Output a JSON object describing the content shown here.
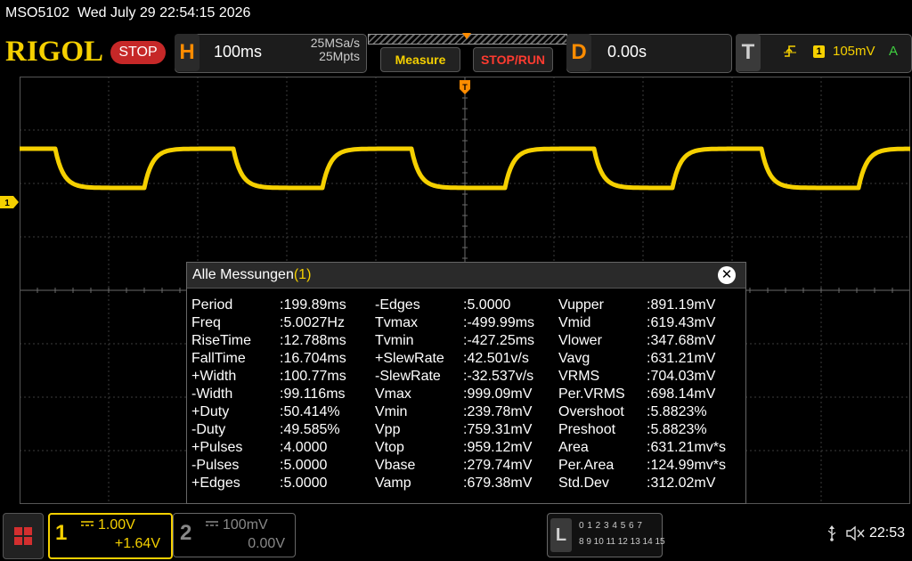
{
  "status": {
    "model": "MSO5102",
    "datetime": "Wed July 29 22:54:15 2026"
  },
  "toolbar": {
    "logo": "RIGOL",
    "run_state": "STOP",
    "horizontal": {
      "letter": "H",
      "timebase": "100ms",
      "sample_rate": "25MSa/s",
      "memory_depth": "25Mpts"
    },
    "measure_label": "Measure",
    "stoprun_label": "STOP/RUN",
    "delay": {
      "letter": "D",
      "value": "0.00s"
    },
    "trigger": {
      "letter": "T",
      "source": "1",
      "level": "105mV",
      "mode": "A",
      "edge_icon": "rising-edge-icon"
    }
  },
  "waveform": {
    "channel": "1",
    "color": "#f5d000",
    "signal": "square",
    "frequency": "5.0027Hz",
    "period": "199.89ms"
  },
  "measurements": {
    "title": "Alle Messungen",
    "title_channel": "(1)",
    "close_icon": "close-icon",
    "columns": [
      [
        {
          "name": "Period",
          "value": ":199.89ms"
        },
        {
          "name": "Freq",
          "value": ":5.0027Hz"
        },
        {
          "name": "RiseTime",
          "value": ":12.788ms"
        },
        {
          "name": "FallTime",
          "value": ":16.704ms"
        },
        {
          "name": "+Width",
          "value": ":100.77ms"
        },
        {
          "name": "-Width",
          "value": ":99.116ms"
        },
        {
          "name": "+Duty",
          "value": ":50.414%"
        },
        {
          "name": "-Duty",
          "value": ":49.585%"
        },
        {
          "name": "+Pulses",
          "value": ":4.0000"
        },
        {
          "name": "-Pulses",
          "value": ":5.0000"
        },
        {
          "name": "+Edges",
          "value": ":5.0000"
        }
      ],
      [
        {
          "name": "-Edges",
          "value": ":5.0000"
        },
        {
          "name": "Tvmax",
          "value": ":-499.99ms"
        },
        {
          "name": "Tvmin",
          "value": ":-427.25ms"
        },
        {
          "name": "+SlewRate",
          "value": ":42.501v/s"
        },
        {
          "name": "-SlewRate",
          "value": ":-32.537v/s"
        },
        {
          "name": "Vmax",
          "value": ":999.09mV"
        },
        {
          "name": "Vmin",
          "value": ":239.78mV"
        },
        {
          "name": "Vpp",
          "value": ":759.31mV"
        },
        {
          "name": "Vtop",
          "value": ":959.12mV"
        },
        {
          "name": "Vbase",
          "value": ":279.74mV"
        },
        {
          "name": "Vamp",
          "value": ":679.38mV"
        }
      ],
      [
        {
          "name": "Vupper",
          "value": ":891.19mV"
        },
        {
          "name": "Vmid",
          "value": ":619.43mV"
        },
        {
          "name": "Vlower",
          "value": ":347.68mV"
        },
        {
          "name": "Vavg",
          "value": ":631.21mV"
        },
        {
          "name": "VRMS",
          "value": ":704.03mV"
        },
        {
          "name": "Per.VRMS",
          "value": ":698.14mV"
        },
        {
          "name": "Overshoot",
          "value": ":5.8823%"
        },
        {
          "name": "Preshoot",
          "value": ":5.8823%"
        },
        {
          "name": "Area",
          "value": ":631.21mv*s"
        },
        {
          "name": "Per.Area",
          "value": ":124.99mv*s"
        },
        {
          "name": "Std.Dev",
          "value": ":312.02mV"
        }
      ]
    ]
  },
  "bottom": {
    "ch1": {
      "number": "1",
      "scale": "1.00V",
      "offset": "+1.64V",
      "color": "#f5d000",
      "marker": "1"
    },
    "ch2": {
      "number": "2",
      "scale": "100mV",
      "offset": "0.00V",
      "color": "#888888"
    },
    "logic": {
      "letter": "L",
      "row1": "0 1 2 3  4 5 6 7",
      "row2": "8 9 10 11  12 13 14 15"
    },
    "clock": "22:53",
    "icons": [
      "menu-icon",
      "usb-icon",
      "speaker-muted-icon"
    ]
  }
}
